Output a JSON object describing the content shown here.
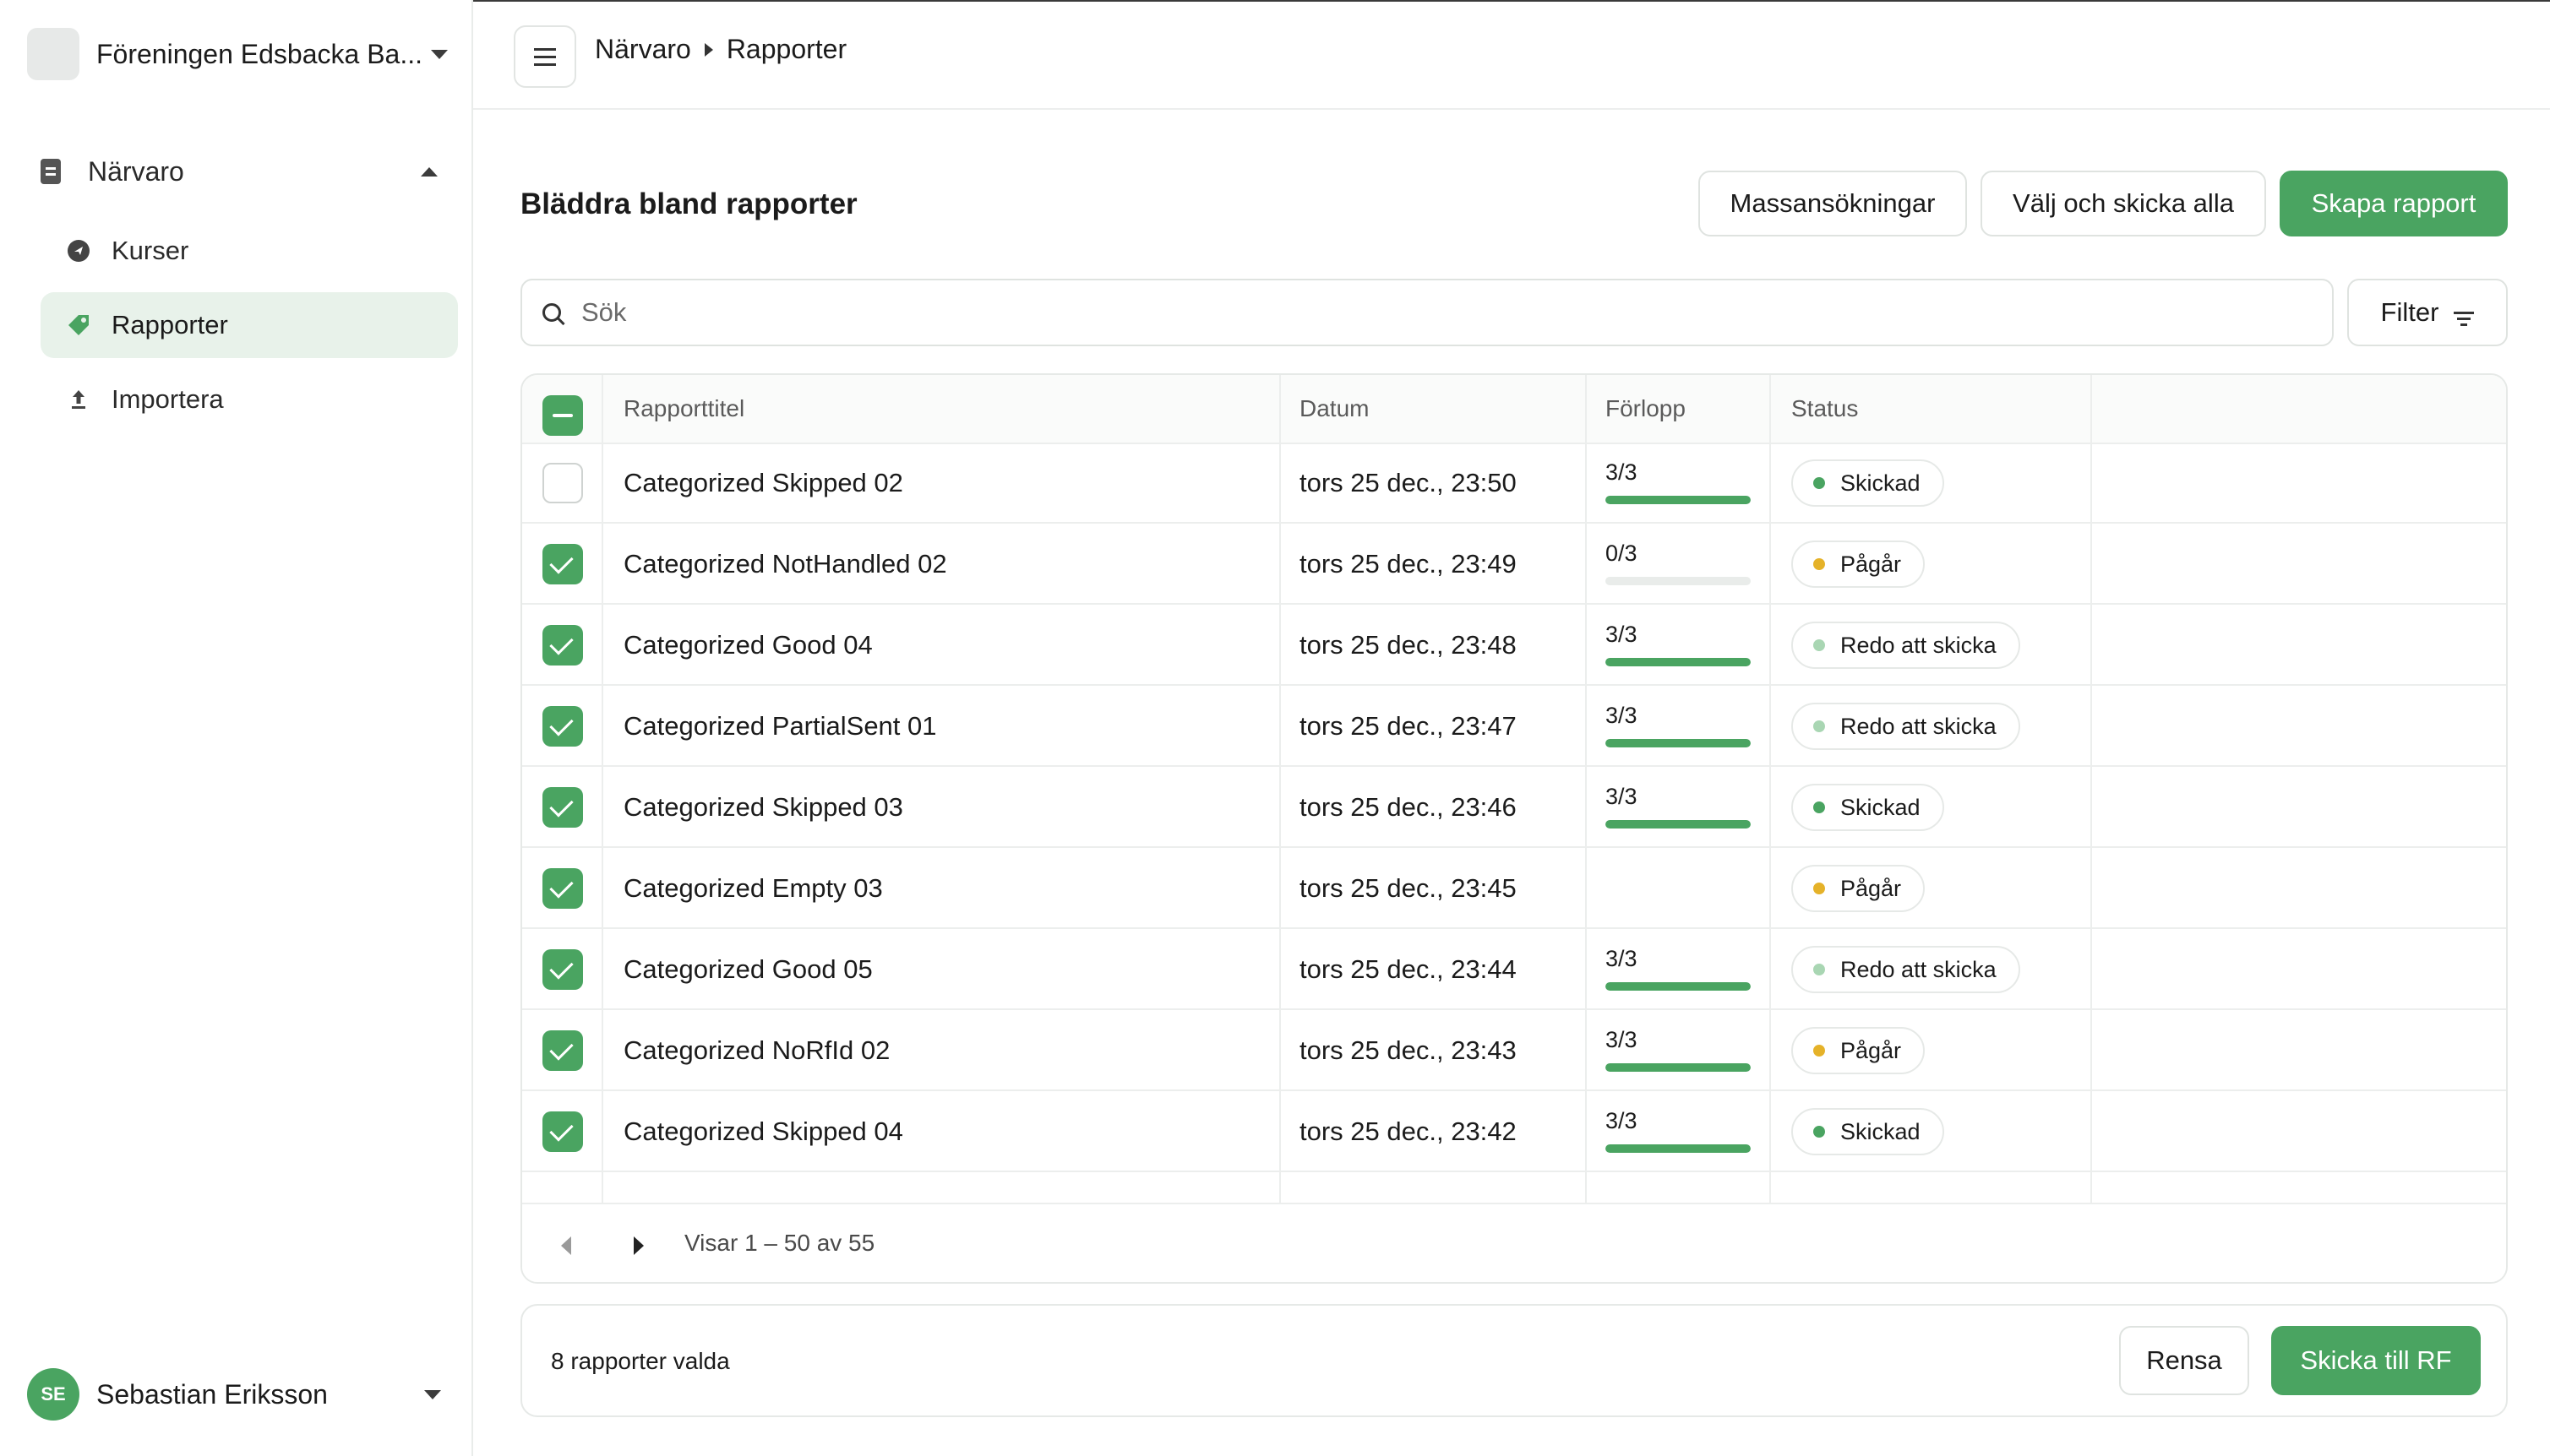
{
  "org": {
    "name": "Föreningen Edsbacka Ba..."
  },
  "sidebar": {
    "group": {
      "label": "Närvaro"
    },
    "items": [
      {
        "label": "Kurser",
        "icon": "course-icon"
      },
      {
        "label": "Rapporter",
        "icon": "tag-icon",
        "active": true
      },
      {
        "label": "Importera",
        "icon": "upload-icon"
      }
    ]
  },
  "user": {
    "initials": "SE",
    "name": "Sebastian Eriksson"
  },
  "breadcrumb": {
    "first": "Närvaro",
    "second": "Rapporter"
  },
  "page": {
    "title": "Bläddra bland rapporter",
    "buttons": {
      "mass": "Massansökningar",
      "select_send_all": "Välj och skicka alla",
      "create": "Skapa rapport"
    }
  },
  "search": {
    "placeholder": "Sök"
  },
  "filter": {
    "label": "Filter"
  },
  "table": {
    "columns": {
      "title": "Rapporttitel",
      "date": "Datum",
      "progress": "Förlopp",
      "status": "Status"
    },
    "rows": [
      {
        "title": "Categorized Skipped 02",
        "date": "tors 25 dec., 23:50",
        "progress": "3/3",
        "progress_fraction": 1,
        "status": "Skickad",
        "status_color": "#4aa461",
        "checked": false
      },
      {
        "title": "Categorized NotHandled 02",
        "date": "tors 25 dec., 23:49",
        "progress": "0/3",
        "progress_fraction": 0,
        "status": "Pågår",
        "status_color": "#e5b229",
        "checked": true
      },
      {
        "title": "Categorized Good 04",
        "date": "tors 25 dec., 23:48",
        "progress": "3/3",
        "progress_fraction": 1,
        "status": "Redo att skicka",
        "status_color": "#a9d6b3",
        "checked": true
      },
      {
        "title": "Categorized PartialSent 01",
        "date": "tors 25 dec., 23:47",
        "progress": "3/3",
        "progress_fraction": 1,
        "status": "Redo att skicka",
        "status_color": "#a9d6b3",
        "checked": true
      },
      {
        "title": "Categorized Skipped 03",
        "date": "tors 25 dec., 23:46",
        "progress": "3/3",
        "progress_fraction": 1,
        "status": "Skickad",
        "status_color": "#4aa461",
        "checked": true
      },
      {
        "title": "Categorized Empty 03",
        "date": "tors 25 dec., 23:45",
        "progress": "",
        "progress_fraction": null,
        "status": "Pågår",
        "status_color": "#e5b229",
        "checked": true
      },
      {
        "title": "Categorized Good 05",
        "date": "tors 25 dec., 23:44",
        "progress": "3/3",
        "progress_fraction": 1,
        "status": "Redo att skicka",
        "status_color": "#a9d6b3",
        "checked": true
      },
      {
        "title": "Categorized NoRfId 02",
        "date": "tors 25 dec., 23:43",
        "progress": "3/3",
        "progress_fraction": 1,
        "status": "Pågår",
        "status_color": "#e5b229",
        "checked": true
      },
      {
        "title": "Categorized Skipped 04",
        "date": "tors 25 dec., 23:42",
        "progress": "3/3",
        "progress_fraction": 1,
        "status": "Skickad",
        "status_color": "#4aa461",
        "checked": true
      }
    ]
  },
  "pager": {
    "text": "Visar 1 – 50 av 55"
  },
  "selection": {
    "text": "8 rapporter valda",
    "clear": "Rensa",
    "send": "Skicka till RF"
  },
  "colors": {
    "accent": "#4aa461",
    "active_bg": "#e8f2ea"
  }
}
